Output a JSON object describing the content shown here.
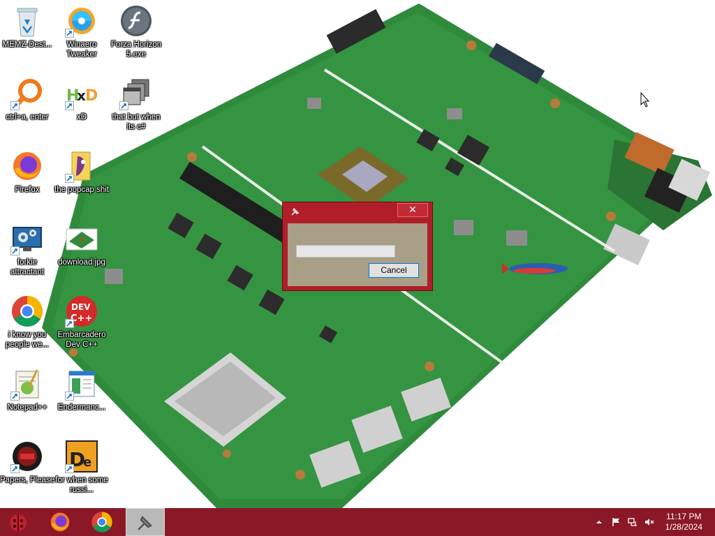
{
  "desktop": {
    "icons": [
      {
        "label": "MEMZ-Dest...",
        "icon": "recycle-bin-icon"
      },
      {
        "label": "Winaero Tweaker",
        "icon": "winaero-tweaker-icon"
      },
      {
        "label": "Forza Horizon 5.exe",
        "icon": "flash-player-icon"
      },
      {
        "label": "ctrl+a, enter",
        "icon": "search-magnifier-icon"
      },
      {
        "label": "xD",
        "icon": "hxd-icon"
      },
      {
        "label": "that but when its c#",
        "icon": "windows-stack-icon"
      },
      {
        "label": "Firefox",
        "icon": "firefox-icon"
      },
      {
        "label": "the popcap shit",
        "icon": "popcap-folder-icon"
      },
      {
        "label": "forkie attractant",
        "icon": "settings-monitor-icon"
      },
      {
        "label": "download.jpg",
        "icon": "image-file-icon"
      },
      {
        "label": "i know you people we...",
        "icon": "chrome-icon"
      },
      {
        "label": "Embarcadero Dev C++",
        "icon": "devcpp-icon"
      },
      {
        "label": "Notepad++",
        "icon": "notepadpp-icon"
      },
      {
        "label": "Endermanc...",
        "icon": "document-window-icon"
      },
      {
        "label": "Papers, Please",
        "icon": "papers-please-icon"
      },
      {
        "label": "for when some russi...",
        "icon": "de-app-icon"
      }
    ]
  },
  "dialog": {
    "title": "",
    "close_label": "✕",
    "cancel_label": "Cancel",
    "progress_fraction": 0
  },
  "taskbar": {
    "items": [
      {
        "name": "start-button",
        "icon": "ladybug-orb-icon"
      },
      {
        "name": "firefox-taskbar",
        "icon": "firefox-icon"
      },
      {
        "name": "chrome-taskbar",
        "icon": "chrome-icon"
      },
      {
        "name": "active-app-taskbar",
        "icon": "pin-app-icon"
      }
    ],
    "clock": {
      "time": "11:17 PM",
      "date": "1/28/2024"
    }
  },
  "colors": {
    "taskbar": "#8a1826",
    "dialog_frame": "#b01e2a",
    "dialog_client": "#a99e86",
    "board_green": "#2f8a3c"
  }
}
